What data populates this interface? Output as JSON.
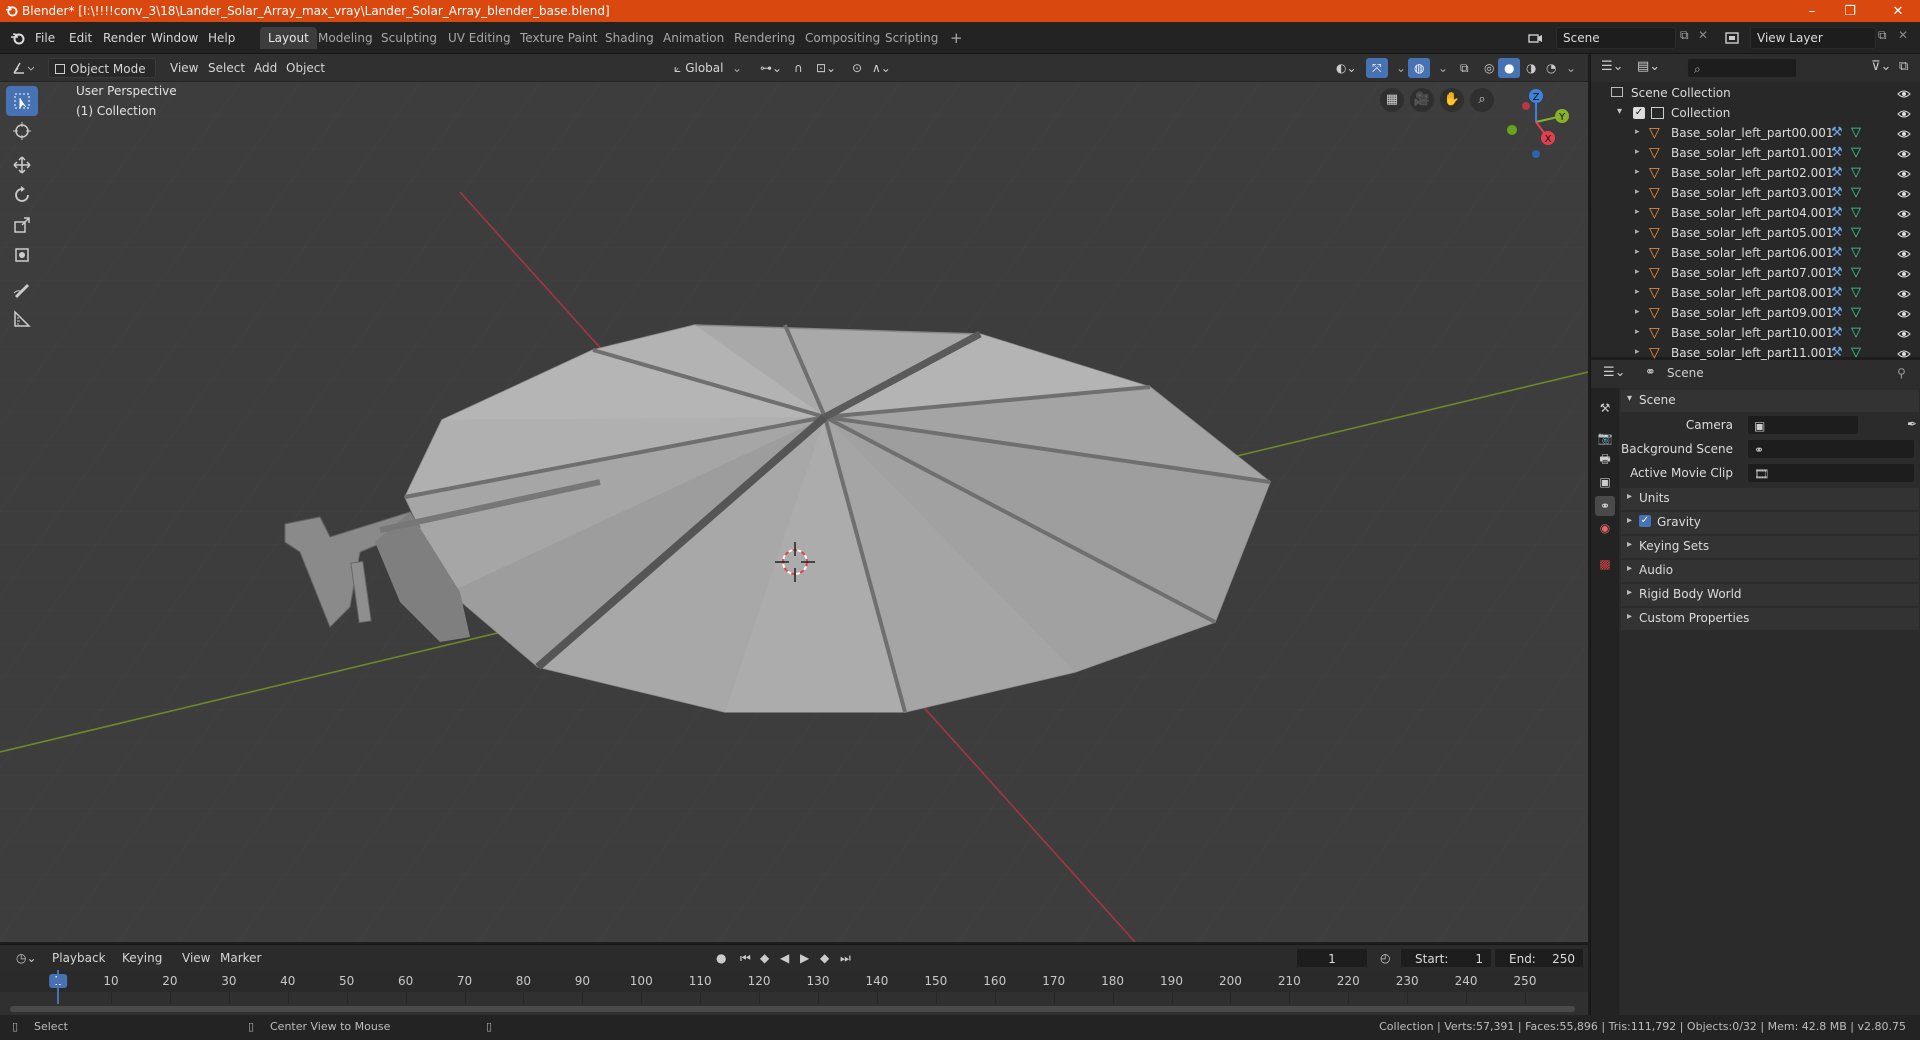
{
  "window": {
    "title": "Blender* [I:\\!!!!conv_3\\18\\Lander_Solar_Array_max_vray\\Lander_Solar_Array_blender_base.blend]",
    "minimize": "–",
    "maximize": "❐",
    "close": "✕"
  },
  "menu": [
    "File",
    "Edit",
    "Render",
    "Window",
    "Help"
  ],
  "workspaces": [
    "Layout",
    "Modeling",
    "Sculpting",
    "UV Editing",
    "Texture Paint",
    "Shading",
    "Animation",
    "Rendering",
    "Compositing",
    "Scripting"
  ],
  "workspace_active": "Layout",
  "scene_field": "Scene",
  "view_layer_field": "View Layer",
  "viewport_header": {
    "mode": "Object Mode",
    "menus": [
      "View",
      "Select",
      "Add",
      "Object"
    ],
    "orientation": "Global"
  },
  "viewport": {
    "perspective": "User Perspective",
    "collection": "(1) Collection",
    "gizmo_axes": {
      "x": "X",
      "y": "Y",
      "z": "Z"
    }
  },
  "outliner": {
    "root": "Scene Collection",
    "collection": "Collection",
    "objects": [
      "Base_solar_left_part00.001",
      "Base_solar_left_part01.001",
      "Base_solar_left_part02.001",
      "Base_solar_left_part03.001",
      "Base_solar_left_part04.001",
      "Base_solar_left_part05.001",
      "Base_solar_left_part06.001",
      "Base_solar_left_part07.001",
      "Base_solar_left_part08.001",
      "Base_solar_left_part09.001",
      "Base_solar_left_part10.001",
      "Base_solar_left_part11.001"
    ]
  },
  "properties": {
    "header": "Scene",
    "panel": "Scene",
    "camera_label": "Camera",
    "background_scene_label": "Background Scene",
    "active_movie_clip_label": "Active Movie Clip",
    "sections": [
      "Units",
      "Gravity",
      "Keying Sets",
      "Audio",
      "Rigid Body World",
      "Custom Properties"
    ],
    "gravity_checked": true
  },
  "timeline": {
    "menus": [
      "Playback",
      "Keying",
      "View",
      "Marker"
    ],
    "current_frame": "1",
    "start_label": "Start:",
    "start": "1",
    "end_label": "End:",
    "end": "250",
    "ticks": [
      "1",
      "10",
      "20",
      "30",
      "40",
      "50",
      "60",
      "70",
      "80",
      "90",
      "100",
      "110",
      "120",
      "130",
      "140",
      "150",
      "160",
      "170",
      "180",
      "190",
      "200",
      "210",
      "220",
      "230",
      "240",
      "250"
    ]
  },
  "status": {
    "left_action": "Select",
    "middle_action": "Center View to Mouse",
    "stats": "Collection | Verts:57,391 | Faces:55,896 | Tris:111,792 | Objects:0/32 | Mem: 42.8 MB | v2.80.75"
  },
  "colors": {
    "accent": "#4772b3",
    "title_bar": "#d9480f",
    "axis_x": "#e3404f",
    "axis_y": "#86b12a",
    "axis_z": "#3c82dc"
  }
}
